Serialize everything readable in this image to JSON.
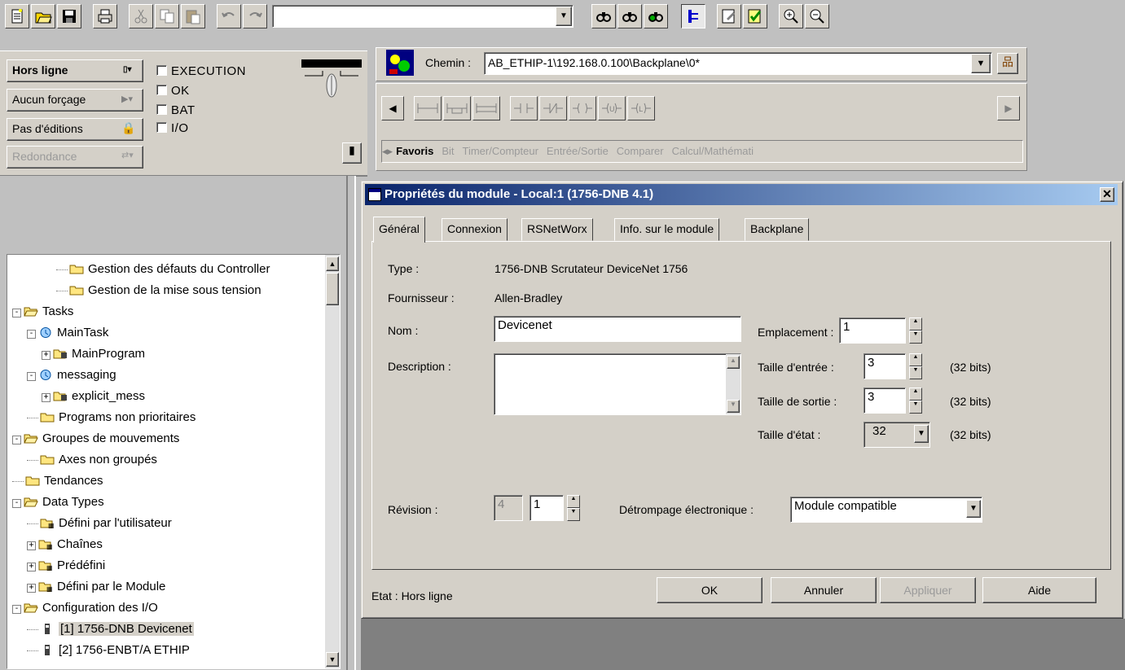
{
  "toolbar": {
    "path_combo_value": "",
    "icons": [
      "new-file-icon",
      "open-folder-icon",
      "save-icon",
      "print-icon",
      "cut-icon",
      "copy-icon",
      "paste-icon",
      "undo-icon",
      "redo-icon",
      "search-icon",
      "find-next-icon",
      "browse-icon",
      "verify-icon",
      "edit-icon",
      "verify-all-icon",
      "zoom-in-icon",
      "zoom-out-icon"
    ]
  },
  "status_panel": {
    "mode": "Hors ligne",
    "forcing": "Aucun forçage",
    "edits": "Pas d'éditions",
    "redundancy": "Redondance",
    "checks": [
      "EXECUTION",
      "OK",
      "BAT",
      "I/O"
    ]
  },
  "path_bar": {
    "label": "Chemin :",
    "value": "AB_ETHIP-1\\192.168.0.100\\Backplane\\0*"
  },
  "instruction_tabs": [
    "Favoris",
    "Bit",
    "Timer/Compteur",
    "Entrée/Sortie",
    "Comparer",
    "Calcul/Mathémati"
  ],
  "tree": [
    {
      "label": "Gestion des défauts du Controller",
      "indent": 3,
      "type": "folder"
    },
    {
      "label": "Gestion de la mise sous tension",
      "indent": 3,
      "type": "folder"
    },
    {
      "label": "Tasks",
      "indent": 0,
      "type": "folder-open",
      "expander": "-"
    },
    {
      "label": "MainTask",
      "indent": 1,
      "type": "task",
      "expander": "-"
    },
    {
      "label": "MainProgram",
      "indent": 2,
      "type": "program",
      "expander": "+"
    },
    {
      "label": "messaging",
      "indent": 1,
      "type": "task",
      "expander": "-"
    },
    {
      "label": "explicit_mess",
      "indent": 2,
      "type": "program",
      "expander": "+"
    },
    {
      "label": "Programs non prioritaires",
      "indent": 1,
      "type": "folder"
    },
    {
      "label": "Groupes de mouvements",
      "indent": 0,
      "type": "folder-open",
      "expander": "-"
    },
    {
      "label": "Axes non groupés",
      "indent": 1,
      "type": "folder"
    },
    {
      "label": "Tendances",
      "indent": 0,
      "type": "folder"
    },
    {
      "label": "Data Types",
      "indent": 0,
      "type": "folder-open",
      "expander": "-"
    },
    {
      "label": "Défini par l'utilisateur",
      "indent": 1,
      "type": "datatype"
    },
    {
      "label": "Chaînes",
      "indent": 1,
      "type": "datatype",
      "expander": "+"
    },
    {
      "label": "Prédéfini",
      "indent": 1,
      "type": "datatype",
      "expander": "+"
    },
    {
      "label": "Défini par le Module",
      "indent": 1,
      "type": "datatype",
      "expander": "+"
    },
    {
      "label": "Configuration des I/O",
      "indent": 0,
      "type": "folder-open",
      "expander": "-"
    },
    {
      "label": "[1] 1756-DNB Devicenet",
      "indent": 1,
      "type": "module",
      "selected": true
    },
    {
      "label": "[2] 1756-ENBT/A ETHIP",
      "indent": 1,
      "type": "module"
    }
  ],
  "dialog": {
    "title": "Propriétés du module  - Local:1 (1756-DNB 4.1)",
    "tabs": [
      "Général",
      "Connexion",
      "RSNetWorx",
      "Info. sur le module",
      "Backplane"
    ],
    "type_label": "Type :",
    "type_value": "1756-DNB Scrutateur DeviceNet 1756",
    "vendor_label": "Fournisseur :",
    "vendor_value": "Allen-Bradley",
    "name_label": "Nom :",
    "name_value": "Devicenet",
    "description_label": "Description :",
    "description_value": "",
    "slot_label": "Emplacement :",
    "slot_value": "1",
    "input_size_label": "Taille d'entrée :",
    "input_size_value": "3",
    "output_size_label": "Taille de sortie :",
    "output_size_value": "3",
    "status_size_label": "Taille d'état :",
    "status_size_value": "32",
    "bits_unit": "(32 bits)",
    "revision_label": "Révision :",
    "revision_major": "4",
    "revision_minor": "1",
    "keying_label": "Détrompage électronique :",
    "keying_value": "Module compatible",
    "state_text": "Etat :  Hors ligne",
    "buttons": {
      "ok": "OK",
      "cancel": "Annuler",
      "apply": "Appliquer",
      "help": "Aide"
    }
  }
}
